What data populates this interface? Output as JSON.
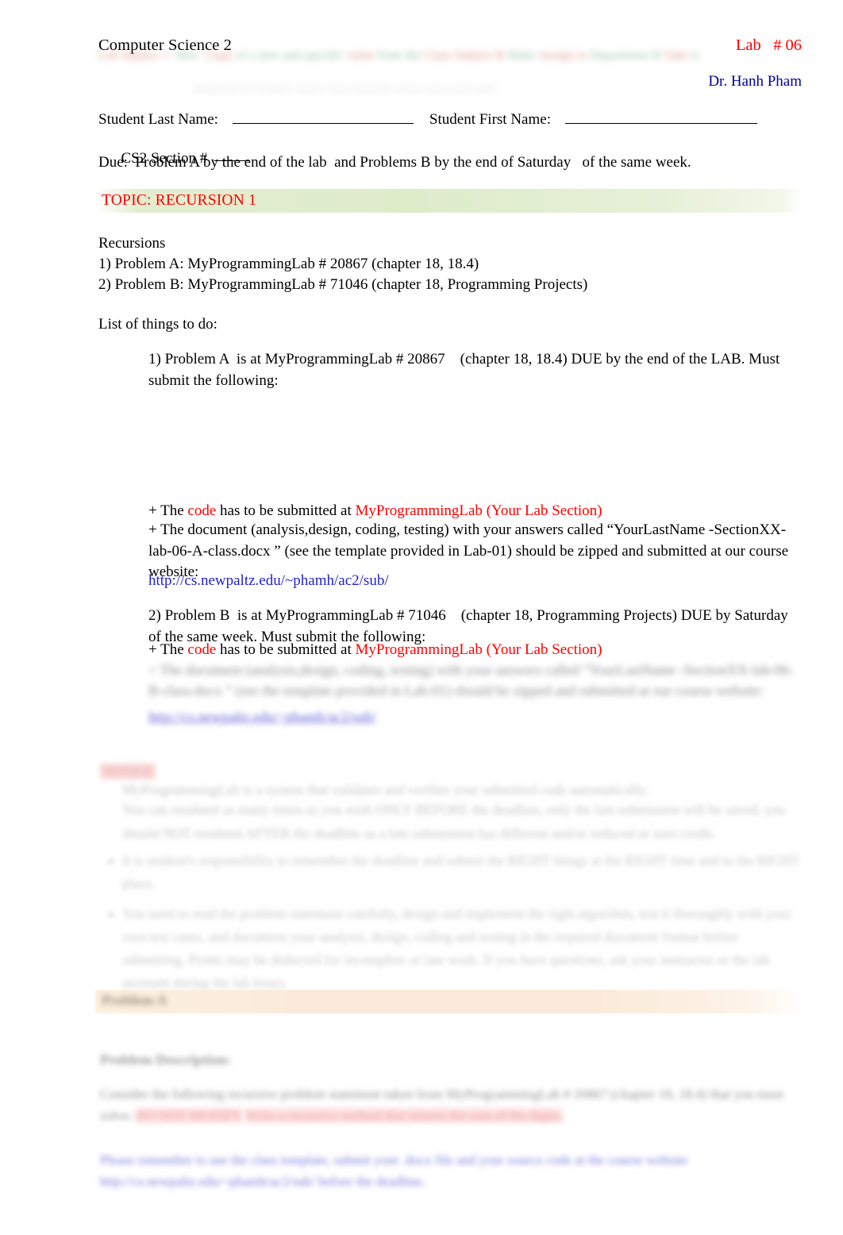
{
  "document": {
    "course_title": "Computer Science 2",
    "lab_number": "Lab   # 06",
    "instructor": "Dr. Hanh Pham",
    "header_smudge": "Lab Subject 1  New  Copy of a new and specific value from the Class Subject B  Make Assign to Department B  Take A",
    "header_smudge2": "department of computer science   state university of new york at new paltz"
  },
  "student_fields": {
    "last_name_label": "Student Last Name:",
    "first_name_label": "Student First Name:",
    "last_name_value": "",
    "first_name_value": "",
    "section_label": "CS2 Section # ",
    "section_value": "",
    "due_line": "Due:  Problem A by the end of the lab  and Problems B by the end of Saturday   of the same week."
  },
  "topic": {
    "banner_text": "TOPIC: RECURSION 1",
    "banner_color": "#dfecca",
    "text_color": "#ff0000"
  },
  "intro": {
    "heading": "Recursions",
    "item1": "1) Problem A: MyProgrammingLab # 20867 (chapter 18, 18.4)",
    "item2": "2) Problem B: MyProgrammingLab # 71046 (chapter 18, Programming Projects)",
    "list_heading": "List of things to do:"
  },
  "problem_a": {
    "line1": "1) Problem A  is at MyProgrammingLab # 20867    (chapter 18, 18.4) DUE by the end of the LAB. Must",
    "line2": "submit the following:",
    "bullet_code_prefix": "+ The ",
    "bullet_code_word": "code",
    "bullet_code_mid": " has to be submitted at ",
    "bullet_code_target": "MyProgrammingLab (Your Lab Section)",
    "bullet_doc": "+ The document (analysis,design, coding, testing) with your answers called “YourLastName   -SectionXX-lab-06-A-class.docx ” (see the template provided in Lab-01) should be zipped and submitted at our course website:",
    "submit_url": "http://cs.newpaltz.edu/~phamh/ac2/sub/"
  },
  "problem_b": {
    "line1": "2) Problem B  is at MyProgrammingLab # 71046    (chapter 18, Programming Projects) DUE by Saturday",
    "line2": "of the same week. Must submit the following:",
    "bullet_code_prefix": "+ The ",
    "bullet_code_word": "code",
    "bullet_code_mid": " has to be submitted at ",
    "bullet_code_target": "MyProgrammingLab (Your Lab Section)",
    "blurred_doc_text": "+ The document (analysis,design, coding, testing) with your answers called “YourLastName -SectionXX-lab-06-B-class.docx ” (see the template provided in Lab-01) should be zipped and submitted at our course website:",
    "blurred_url": "http://cs.newpaltz.edu/~phamh/ac2/sub/"
  },
  "notices": {
    "tag": "NOTICE",
    "line1": "MyProgrammingLab is a system that validates and verifies your submitted code automatically.",
    "line2": "You can resubmit as many times as you wish ONLY BEFORE the deadline, only the last submission will be saved; you should NOT resubmit AFTER the deadline as a late submission has different and/or reduced or zero credit.",
    "bullets": [
      "It is student's responsibility to remember the deadline and submit the RIGHT things at the RIGHT time and to the RIGHT place.",
      "You need to read the problem statement carefully, design and implement the right algorithm, test it thoroughly with your own test cases, and document your analysis, design, coding and testing in the required document format before submitting. Points may be deducted for incomplete or late work. If you have questions, ask your instructor or the lab assistant during the lab hours."
    ]
  },
  "problem_section": {
    "banner_title": "Problem A",
    "banner_color": "#fbead9",
    "description_heading": "Problem Description:",
    "body_line1": "Consider the following recursive problem statement taken from MyProgrammingLab # 20867 (chapter 18, 18.4) that you must solve:",
    "body_line2": "Write a recursive method that returns the sum of the digits.",
    "body_red": "DO NOT MODIFY",
    "footer_line": "Please remember to use the class template, submit your .docx file and your source code at the course website http://cs.newpaltz.edu/~phamh/ac2/sub/ before the deadline."
  }
}
